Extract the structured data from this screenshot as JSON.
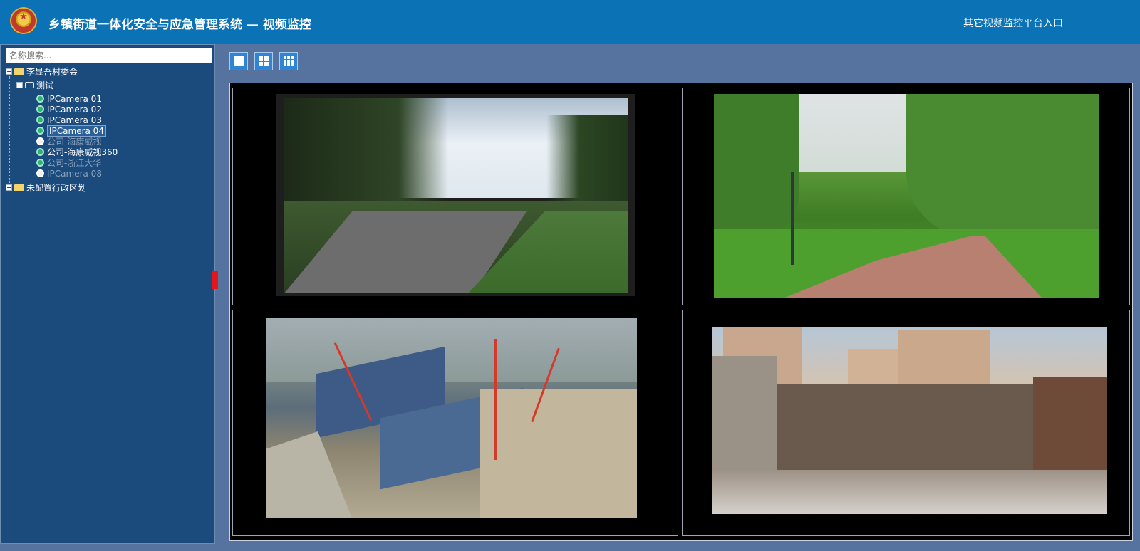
{
  "header": {
    "title": "乡镇街道一体化安全与应急管理系统 — 视频监控",
    "platform_link": "其它视频监控平台入口"
  },
  "sidebar": {
    "search_placeholder": "名称搜索...",
    "tree": {
      "root": "李显吾村委会",
      "group": "测试",
      "cameras": [
        {
          "label": "IPCamera 01",
          "status": "online"
        },
        {
          "label": "IPCamera 02",
          "status": "online"
        },
        {
          "label": "IPCamera 03",
          "status": "online"
        },
        {
          "label": "IPCamera 04",
          "status": "online",
          "selected": true
        },
        {
          "label": "公司-海康威视",
          "status": "offline"
        },
        {
          "label": "公司-海康威视360",
          "status": "online"
        },
        {
          "label": "公司-浙江大华",
          "status": "offline"
        },
        {
          "label": "IPCamera 08",
          "status": "offline"
        }
      ],
      "unassigned": "未配置行政区划"
    }
  },
  "toolbar": {
    "layouts": [
      "single-icon",
      "quad-grid-icon",
      "nine-grid-icon"
    ]
  },
  "video_wall": {
    "layout": "2x2",
    "feeds": [
      {
        "scene": "park-path"
      },
      {
        "scene": "green-park"
      },
      {
        "scene": "construction-aerial"
      },
      {
        "scene": "building-site"
      }
    ]
  },
  "colors": {
    "header": "#0a72b5",
    "background": "#5673a0",
    "sidebar": "#1b4a7c",
    "online_camera": "#2db37a",
    "collapse_handle": "#e3161d"
  }
}
